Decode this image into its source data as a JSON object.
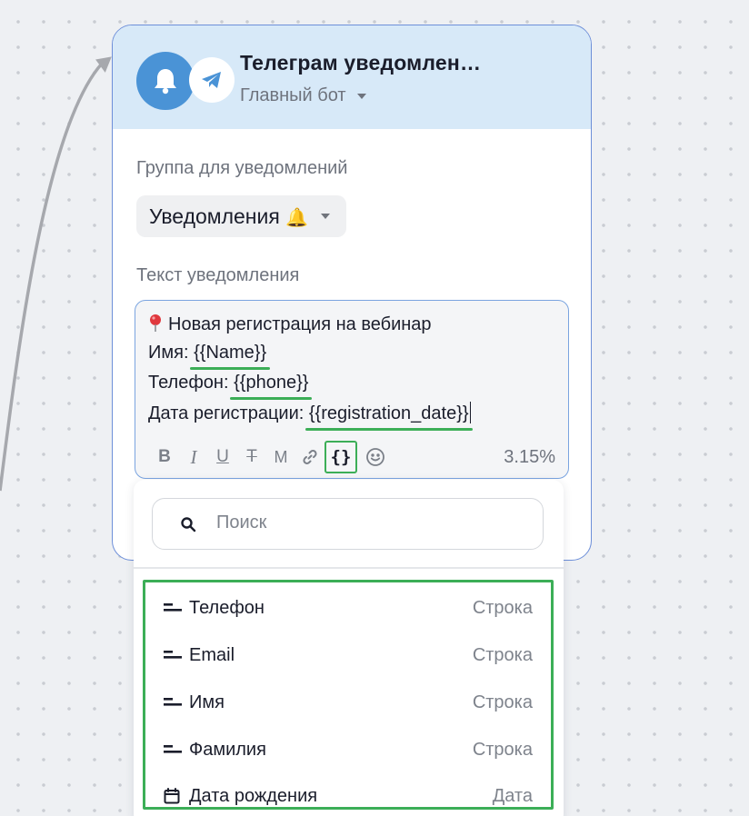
{
  "node": {
    "title": "Телеграм уведомлен…",
    "bot": "Главный бот",
    "icons": [
      "bell-icon",
      "telegram-icon"
    ]
  },
  "group": {
    "label": "Группа для уведомлений",
    "value": "Уведомления",
    "emoji": "🔔"
  },
  "message": {
    "label": "Текст уведомления",
    "line1": "Новая регистрация на вебинар",
    "line1_icon": "pin-icon",
    "line2_prefix": "Имя: ",
    "line2_var": "{{Name}}",
    "line3_prefix": "Телефон: ",
    "line3_var": "{{phone}}",
    "line4_prefix": "Дата регистрации: ",
    "line4_var": "{{registration_date}}",
    "percent": "3.15%"
  },
  "toolbar": {
    "bold": "B",
    "italic": "I",
    "underline": "U",
    "strike": "T",
    "monospace": "M",
    "variables": "{}"
  },
  "dropdown": {
    "search_placeholder": "Поиск",
    "items": [
      {
        "name": "Телефон",
        "type": "Строка",
        "icon": "text-field-icon"
      },
      {
        "name": "Email",
        "type": "Строка",
        "icon": "text-field-icon"
      },
      {
        "name": "Имя",
        "type": "Строка",
        "icon": "text-field-icon"
      },
      {
        "name": "Фамилия",
        "type": "Строка",
        "icon": "text-field-icon"
      },
      {
        "name": "Дата рождения",
        "type": "Дата",
        "icon": "calendar-icon"
      }
    ]
  },
  "colors": {
    "accent": "#4a93d6",
    "highlight": "#3cae57",
    "header_bg": "#d7e9f8",
    "card_border": "#6d8fd9"
  }
}
